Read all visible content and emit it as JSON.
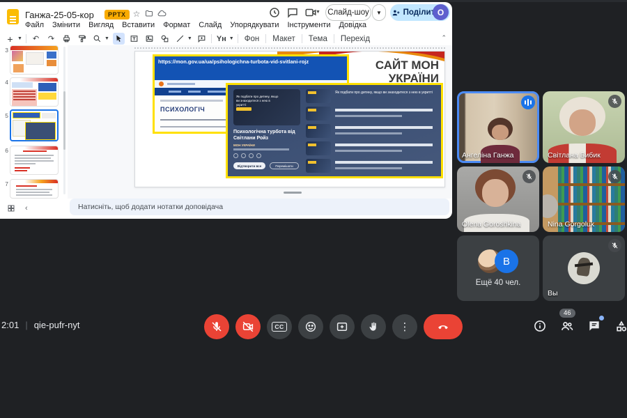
{
  "app": {
    "title": "Ганжа-25-05-кор",
    "format_badge": "PPTX",
    "menus": [
      "Файл",
      "Змінити",
      "Вигляд",
      "Вставити",
      "Формат",
      "Слайд",
      "Упорядкувати",
      "Інструменти",
      "Довідка"
    ],
    "toolbar": {
      "font_tool": "Yн",
      "background": "Фон",
      "layout": "Макет",
      "theme": "Тема",
      "transition": "Перехід"
    },
    "slideshow_button": "Слайд-шоу",
    "share_button": "Поділитися",
    "account_letter": "O",
    "notes_placeholder": "Натисніть, щоб додати нотатки доповідача",
    "thumb_numbers": [
      "3",
      "4",
      "5",
      "6",
      "7"
    ]
  },
  "slide": {
    "url_text": "https://mon.gov.ua/ua/psihologichna-turbota-vid-svitlani-rojz",
    "site_title_line1": "САЙТ МОН",
    "site_title_line2": "УКРАЇНИ",
    "page_heading": "ПСИХОЛОГІЧ",
    "featured_overlay": "Як подбати про дитину, якщо ви знаходитеся з нею в укритті",
    "playlist_title": "Психологічна турбота від Світлани Ройз",
    "playlist_channel": "МОН УКРАЇНИ",
    "play_all_button": "Відтворити все",
    "shuffle_button": "Перемішати",
    "list_item_1": "Як подбати про дитину, якщо ви знаходитеся з нею в укритті"
  },
  "meet": {
    "time": "2:01",
    "code": "qie-pufr-nyt",
    "participants_badge": "46",
    "cc_label": "CC",
    "tiles": [
      {
        "name": "Ангеліна Ганжа"
      },
      {
        "name": "Світлана Бибик"
      },
      {
        "name": "Olena Goroshkina"
      },
      {
        "name": "Nina Gorgoluk"
      },
      {
        "name": "Ещё 40 чел.",
        "avatar_letter": "В"
      },
      {
        "name": "Вы"
      }
    ]
  },
  "colors": {
    "accent_blue": "#1a73e8",
    "danger_red": "#ea4335",
    "share_bg": "#c2e7ff",
    "badge_orange": "#f9ab00",
    "highlight_yellow": "#ffe000"
  }
}
